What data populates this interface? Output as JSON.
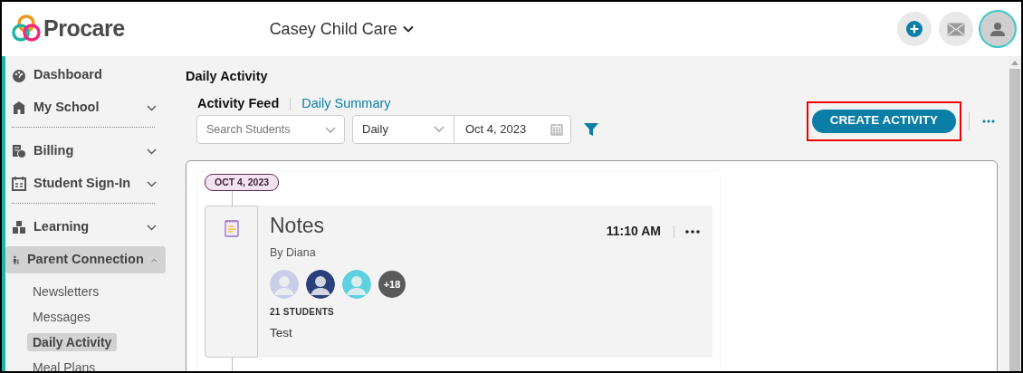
{
  "brand": {
    "name": "Procare"
  },
  "school": {
    "name": "Casey Child Care"
  },
  "sidebar": {
    "items": [
      {
        "label": "Dashboard",
        "kind": "link",
        "selected": false
      },
      {
        "label": "My School",
        "kind": "group",
        "expanded": false,
        "selected": false,
        "divider_after": true
      },
      {
        "label": "Billing",
        "kind": "group",
        "expanded": false,
        "selected": false
      },
      {
        "label": "Student Sign-In",
        "kind": "group",
        "expanded": false,
        "selected": false,
        "divider_after": true
      },
      {
        "label": "Learning",
        "kind": "group",
        "expanded": false,
        "selected": false
      },
      {
        "label": "Parent Connection",
        "kind": "group",
        "expanded": true,
        "selected": true,
        "children": [
          {
            "label": "Newsletters",
            "selected": false
          },
          {
            "label": "Messages",
            "selected": false
          },
          {
            "label": "Daily Activity",
            "selected": true
          },
          {
            "label": "Meal Plans",
            "selected": false
          }
        ]
      }
    ]
  },
  "page_title": "Daily Activity",
  "tabs": [
    {
      "label": "Activity Feed",
      "selected": true
    },
    {
      "label": "Daily Summary",
      "selected": false
    }
  ],
  "filters": {
    "search": {
      "placeholder": "Search Students"
    },
    "period": {
      "value": "Daily"
    },
    "date": {
      "value": "Oct 4, 2023"
    }
  },
  "create_button": {
    "label": "CREATE ACTIVITY",
    "highlighted": true
  },
  "feed": {
    "date_badge": "OCT 4, 2023",
    "activities": [
      {
        "title": "Notes",
        "author": "By Diana",
        "time": "11:10 AM",
        "avatars": [
          {
            "color": "#c9cde8"
          },
          {
            "color": "#2b3f7a"
          },
          {
            "color": "#5fd0e0"
          }
        ],
        "extra_count": "+18",
        "student_count": "21 STUDENTS",
        "text": "Test"
      }
    ]
  }
}
